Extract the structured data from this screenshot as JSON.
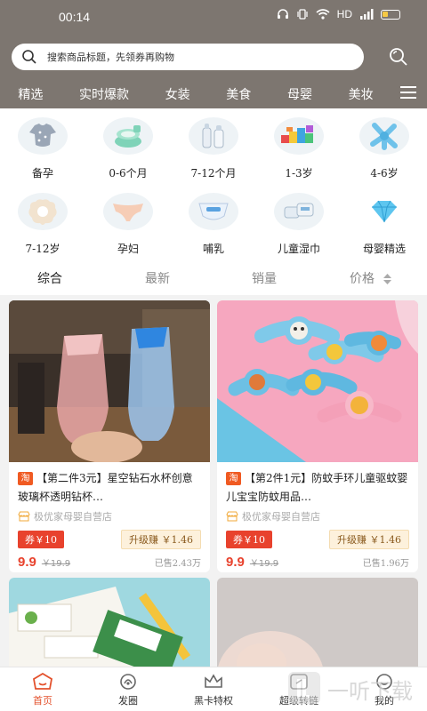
{
  "status_bar": {
    "time": "00:14",
    "network": "HD"
  },
  "search": {
    "placeholder": "搜索商品标题，先领券再购物"
  },
  "category_tabs": [
    "精选",
    "实时爆款",
    "女装",
    "美食",
    "母婴",
    "美妆"
  ],
  "grid": [
    {
      "label": "备孕",
      "icon": "onesie-icon"
    },
    {
      "label": "0-6个月",
      "icon": "potty-icon"
    },
    {
      "label": "7-12个月",
      "icon": "bottles-icon"
    },
    {
      "label": "1-3岁",
      "icon": "blocks-icon"
    },
    {
      "label": "4-6岁",
      "icon": "teether-icon"
    },
    {
      "label": "7-12岁",
      "icon": "bib-icon"
    },
    {
      "label": "孕妇",
      "icon": "underwear-icon"
    },
    {
      "label": "哺乳",
      "icon": "diaper-icon"
    },
    {
      "label": "儿童湿巾",
      "icon": "wipes-icon"
    },
    {
      "label": "母婴精选",
      "icon": "diamond-icon"
    }
  ],
  "sort": {
    "items": [
      "综合",
      "最新",
      "销量",
      "价格"
    ],
    "active": "综合"
  },
  "products": [
    {
      "badge": "淘",
      "title": "【第二件3元】星空钻石水杯创意玻璃杯透明钻杯…",
      "shop": "极优家母婴自营店",
      "coupon": "券￥10",
      "upgrade": "升级赚 ￥1.46",
      "price": "9.9",
      "original": "￥19.9",
      "sold": "已售2.43万"
    },
    {
      "badge": "淘",
      "title": "【第2件1元】防蚊手环儿童驱蚊婴儿宝宝防蚊用品…",
      "shop": "极优家母婴自营店",
      "coupon": "券￥10",
      "upgrade": "升级赚 ￥1.46",
      "price": "9.9",
      "original": "￥19.9",
      "sold": "已售1.96万"
    }
  ],
  "bottom_nav": [
    {
      "label": "首页",
      "icon": "home-icon",
      "active": true
    },
    {
      "label": "发圈",
      "icon": "broadcast-icon"
    },
    {
      "label": "黑卡特权",
      "icon": "crown-icon"
    },
    {
      "label": "超级转链",
      "icon": "link-icon"
    },
    {
      "label": "我的",
      "icon": "smile-icon"
    }
  ],
  "watermark": {
    "text": "一听下载"
  },
  "colors": {
    "header": "#7d7670",
    "accent": "#e8422d",
    "active_nav": "#e3512c"
  }
}
